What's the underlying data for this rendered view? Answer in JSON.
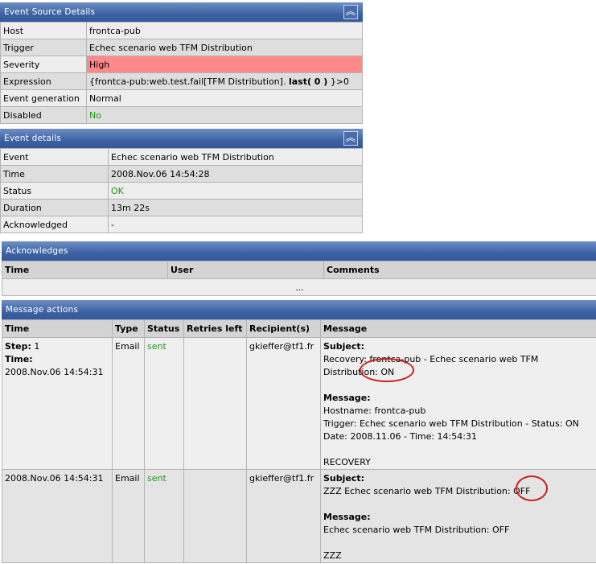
{
  "event_source": {
    "title": "Event Source Details",
    "rows": [
      {
        "label": "Host",
        "value": "frontca-pub"
      },
      {
        "label": "Trigger",
        "value": "Echec scenario web TFM Distribution"
      },
      {
        "label": "Severity",
        "value": "High"
      },
      {
        "label": "Expression",
        "value_prefix": "{frontca-pub:web.test.fail[TFM Distribution].",
        "value_bold": "last( 0 )",
        "value_suffix": "}>0"
      },
      {
        "label": "Event generation",
        "value": "Normal"
      },
      {
        "label": "Disabled",
        "value": "No"
      }
    ]
  },
  "event_details": {
    "title": "Event details",
    "rows": [
      {
        "label": "Event",
        "value": "Echec scenario web TFM Distribution"
      },
      {
        "label": "Time",
        "value": "2008.Nov.06 14:54:28"
      },
      {
        "label": "Status",
        "value": "OK"
      },
      {
        "label": "Duration",
        "value": "13m 22s"
      },
      {
        "label": "Acknowledged",
        "value": "-"
      }
    ]
  },
  "acknowledges": {
    "title": "Acknowledges",
    "columns": [
      "Time",
      "User",
      "Comments"
    ],
    "empty": "..."
  },
  "message_actions": {
    "title": "Message actions",
    "columns": [
      "Time",
      "Type",
      "Status",
      "Retries left",
      "Recipient(s)",
      "Message"
    ],
    "rows": [
      {
        "step_label": "Step:",
        "step": "1",
        "time_label": "Time:",
        "time": "2008.Nov.06 14:54:31",
        "type": "Email",
        "status": "sent",
        "retries": "",
        "recipient": "gkieffer@tf1.fr",
        "subject_label": "Subject:",
        "subject": "Recovery: frontca-pub - Echec scenario web TFM Distribution: ON",
        "message_label": "Message:",
        "message_lines": [
          "Hostname: frontca-pub",
          "Trigger: Echec scenario web TFM Distribution - Status: ON",
          "Date: 2008.11.06 - Time: 14:54:31",
          "",
          "RECOVERY"
        ]
      },
      {
        "time": "2008.Nov.06 14:54:31",
        "type": "Email",
        "status": "sent",
        "retries": "",
        "recipient": "gkieffer@tf1.fr",
        "subject_label": "Subject:",
        "subject": "ZZZ Echec scenario web TFM Distribution: OFF",
        "message_label": "Message:",
        "message_lines": [
          "Echec scenario web TFM Distribution: OFF",
          "",
          "ZZZ"
        ]
      }
    ]
  },
  "colors": {
    "header": "#3d62a3",
    "severity_high": "#ff8888",
    "ok": "#1a9a1a",
    "annotation": "#c82020"
  }
}
